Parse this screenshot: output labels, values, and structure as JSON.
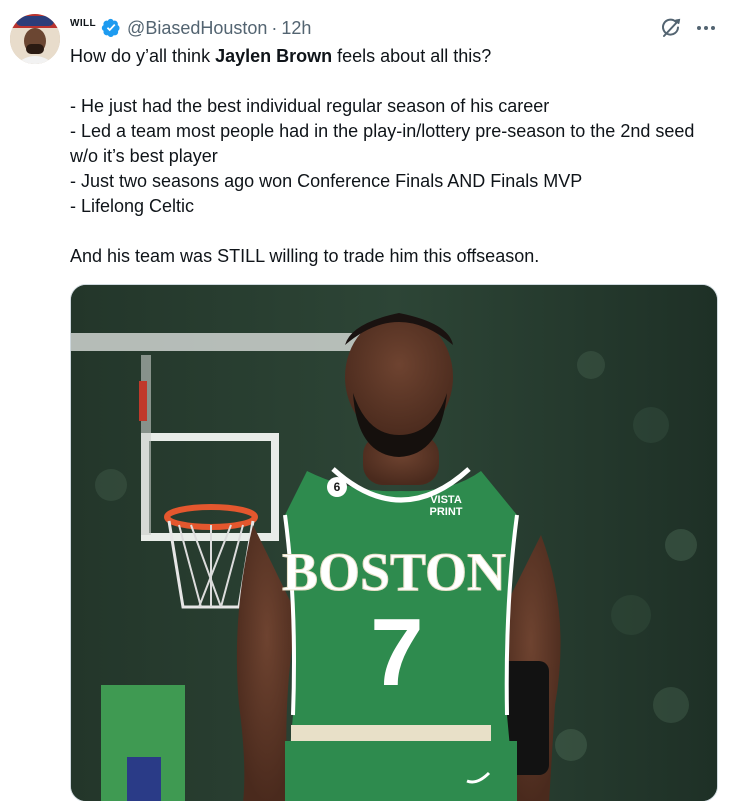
{
  "author": {
    "display_name": "WILL",
    "handle": "@BiasedHouston",
    "separator": "·",
    "time": "12h"
  },
  "tweet": {
    "lead_before": "How do y’all think ",
    "lead_bold": "Jaylen Brown",
    "lead_after": " feels about all this?",
    "bullets": [
      "- He just had the best individual regular season of his career",
      "- Led a team most people had in the play-in/lottery pre-season to the 2nd seed w/o it’s best player",
      "- Just two seasons ago won Conference Finals AND Finals MVP",
      "- Lifelong Celtic"
    ],
    "closing": "And his team was STILL willing to trade him this offseason."
  },
  "media": {
    "jersey_patch_number": "6",
    "jersey_sponsor_line1": "VISTA",
    "jersey_sponsor_line2": "PRINT",
    "jersey_wordmark": "BOSTON",
    "jersey_number": "7"
  },
  "icons": [
    "verified-badge-icon",
    "grok-icon",
    "more-options-icon"
  ],
  "colors": {
    "text": "#0f1419",
    "secondary": "#536471",
    "verified": "#1d9bf0",
    "jersey_green": "#2e8b4e"
  }
}
